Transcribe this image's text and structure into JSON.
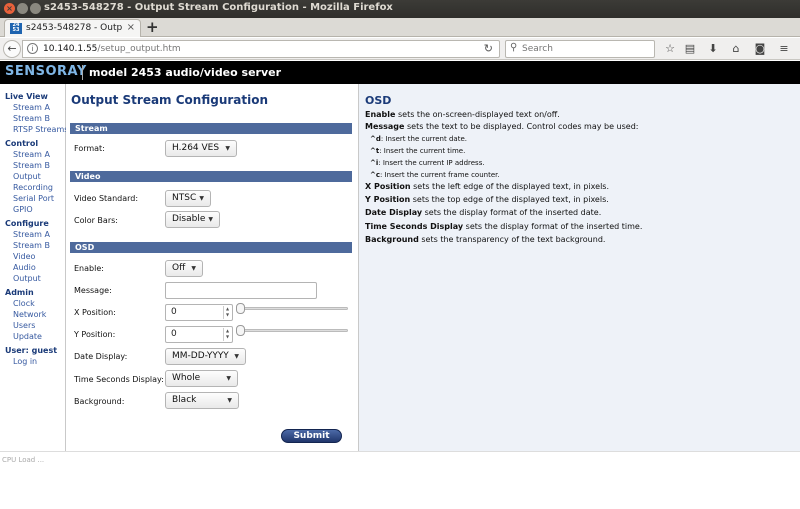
{
  "window": {
    "title": "s2453-548278 - Output Stream Configuration - Mozilla Firefox"
  },
  "tab": {
    "label": "s2453-548278 - Outp…",
    "favicon": "sensoray-favicon"
  },
  "navbar": {
    "url_host": "10.140.1.55",
    "url_path": "/setup_output.htm",
    "search_placeholder": "Search"
  },
  "header": {
    "brand": "SENSORAY",
    "model": "model 2453 audio/video server"
  },
  "sidebar": {
    "live_view": {
      "heading": "Live View",
      "items": [
        "Stream A",
        "Stream B",
        "RTSP Streams"
      ]
    },
    "control": {
      "heading": "Control",
      "items": [
        "Stream A",
        "Stream B",
        "Output",
        "Recording",
        "Serial Port",
        "GPIO"
      ]
    },
    "configure": {
      "heading": "Configure",
      "items": [
        "Stream A",
        "Stream B",
        "Video",
        "Audio",
        "Output"
      ]
    },
    "admin": {
      "heading": "Admin",
      "items": [
        "Clock",
        "Network",
        "Users",
        "Update"
      ]
    },
    "user": {
      "heading": "User: guest",
      "items": [
        "Log in"
      ]
    }
  },
  "form": {
    "title": "Output Stream Configuration",
    "stream": {
      "heading": "Stream",
      "format_label": "Format:",
      "format_value": "H.264 VES"
    },
    "video": {
      "heading": "Video",
      "standard_label": "Video Standard:",
      "standard_value": "NTSC",
      "colorbars_label": "Color Bars:",
      "colorbars_value": "Disable"
    },
    "osd": {
      "heading": "OSD",
      "enable_label": "Enable:",
      "enable_value": "Off",
      "message_label": "Message:",
      "message_value": "",
      "xpos_label": "X Position:",
      "xpos_value": "0",
      "ypos_label": "Y Position:",
      "ypos_value": "0",
      "date_label": "Date Display:",
      "date_value": "MM-DD-YYYY",
      "time_label": "Time Seconds Display:",
      "time_value": "Whole",
      "background_label": "Background:",
      "background_value": "Black"
    },
    "submit_label": "Submit"
  },
  "help": {
    "title": "OSD",
    "lines": [
      {
        "term": "Enable",
        "text": " sets the on-screen-displayed text on/off."
      },
      {
        "term": "Message",
        "text": " sets the text to be displayed. Control codes may be used:"
      }
    ],
    "codes": [
      {
        "code": "^d",
        "text": ": Insert the current date."
      },
      {
        "code": "^t",
        "text": ": Insert the current time."
      },
      {
        "code": "^i",
        "text": ": Insert the current IP address."
      },
      {
        "code": "^c",
        "text": ": Insert the current frame counter."
      }
    ],
    "lines2": [
      {
        "term": "X Position",
        "text": " sets the left edge of the displayed text, in pixels."
      },
      {
        "term": "Y Position",
        "text": " sets the top edge of the displayed text, in pixels."
      },
      {
        "term": "Date Display",
        "text": " sets the display format of the inserted date."
      },
      {
        "term": "Time Seconds Display",
        "text": " sets the display format of the inserted time."
      },
      {
        "term": "Background",
        "text": " sets the transparency of the text background."
      }
    ]
  },
  "footer": {
    "cpu_load": "CPU Load ..."
  },
  "colors": {
    "section_bar": "#4e6a9c",
    "title_blue": "#1a3a78",
    "help_bg": "#eef2f8",
    "brand": "#7fb6e6"
  }
}
